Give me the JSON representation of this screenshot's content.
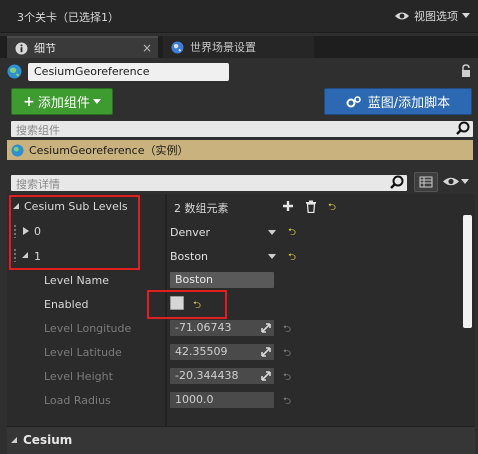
{
  "header": {
    "level_count": "3个关卡（已选择1）",
    "view_options": "视图选项",
    "eye_icon": "eye-icon",
    "dropdown_icon": "chevron-down-icon"
  },
  "tabs": [
    {
      "label": "细节",
      "icon": "info-icon"
    },
    {
      "label": "世界场景设置",
      "icon": "globe-icon"
    }
  ],
  "actor": {
    "name": "CesiumGeoreference"
  },
  "toolbar": {
    "add_component": "添加组件",
    "blueprint": "蓝图/添加脚本"
  },
  "components": {
    "search_placeholder": "搜索组件",
    "items": [
      {
        "label": "CesiumGeoreference（实例）"
      }
    ]
  },
  "details": {
    "search_placeholder": "搜索详情",
    "sub_levels": {
      "label": "Cesium Sub Levels",
      "count": "2 数组元素",
      "elements": [
        {
          "index": "0",
          "value": "Denver"
        },
        {
          "index": "1",
          "value": "Boston"
        }
      ],
      "properties": [
        {
          "label": "Level Name",
          "value": "Boston",
          "enabled": true
        },
        {
          "label": "Enabled",
          "value": "",
          "enabled": true
        },
        {
          "label": "Level Longitude",
          "value": "-71.06743",
          "enabled": false
        },
        {
          "label": "Level Latitude",
          "value": "42.35509",
          "enabled": false
        },
        {
          "label": "Level Height",
          "value": "-20.344438",
          "enabled": false
        },
        {
          "label": "Load Radius",
          "value": "1000.0",
          "enabled": false
        }
      ]
    },
    "section_cesium": "Cesium"
  },
  "colors": {
    "add_button": "#3d9b2f",
    "blueprint_button": "#2c69b2",
    "component_highlight": "#c9b27e",
    "highlight_box": "#e02020",
    "reset_arrow": "#e0d23c"
  }
}
